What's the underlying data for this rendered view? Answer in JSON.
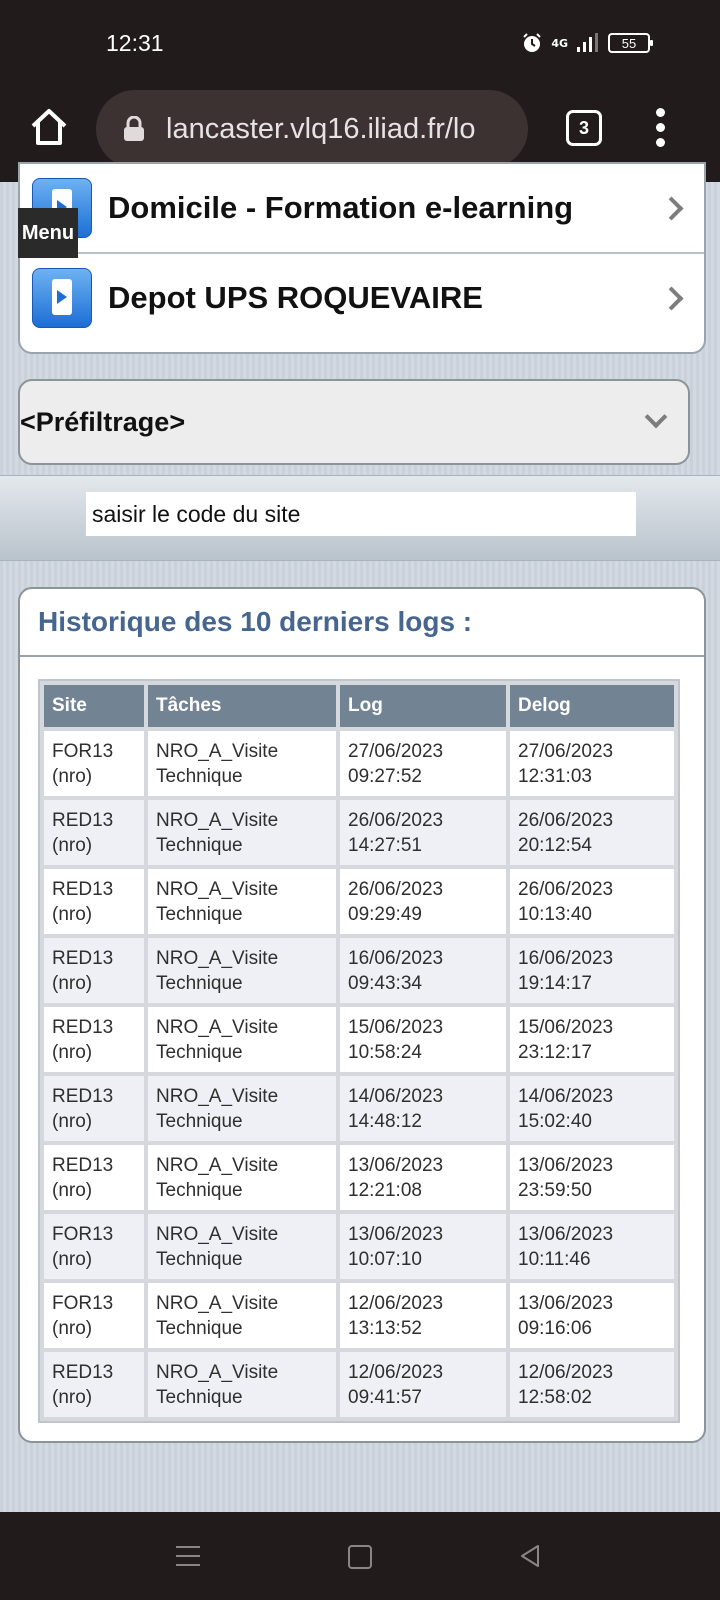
{
  "status_bar": {
    "time": "12:31",
    "network": "4G",
    "battery": "55"
  },
  "browser": {
    "url": "lancaster.vlq16.iliad.fr/lo",
    "tab_count": "3"
  },
  "menu_button_label": "Menu",
  "menu_items": [
    {
      "label": "Domicile - Formation e-learning",
      "icon": "phone-arrow-icon"
    },
    {
      "label": "Depot UPS ROQUEVAIRE",
      "icon": "phone-arrow-icon"
    }
  ],
  "prefilter": {
    "label": "<Préfiltrage>"
  },
  "site_search": {
    "placeholder": "saisir le code du site"
  },
  "history": {
    "title": "Historique des 10 derniers logs :",
    "columns": [
      "Site",
      "Tâches",
      "Log",
      "Delog"
    ],
    "rows": [
      {
        "site": "FOR13",
        "site_type": "(nro)",
        "task": "NRO_A_Visite",
        "task2": "Technique",
        "log_date": "27/06/2023",
        "log_time": "09:27:52",
        "delog_date": "27/06/2023",
        "delog_time": "12:31:03"
      },
      {
        "site": "RED13",
        "site_type": "(nro)",
        "task": "NRO_A_Visite",
        "task2": "Technique",
        "log_date": "26/06/2023",
        "log_time": "14:27:51",
        "delog_date": "26/06/2023",
        "delog_time": "20:12:54"
      },
      {
        "site": "RED13",
        "site_type": "(nro)",
        "task": "NRO_A_Visite",
        "task2": "Technique",
        "log_date": "26/06/2023",
        "log_time": "09:29:49",
        "delog_date": "26/06/2023",
        "delog_time": "10:13:40"
      },
      {
        "site": "RED13",
        "site_type": "(nro)",
        "task": "NRO_A_Visite",
        "task2": "Technique",
        "log_date": "16/06/2023",
        "log_time": "09:43:34",
        "delog_date": "16/06/2023",
        "delog_time": "19:14:17"
      },
      {
        "site": "RED13",
        "site_type": "(nro)",
        "task": "NRO_A_Visite",
        "task2": "Technique",
        "log_date": "15/06/2023",
        "log_time": "10:58:24",
        "delog_date": "15/06/2023",
        "delog_time": "23:12:17"
      },
      {
        "site": "RED13",
        "site_type": "(nro)",
        "task": "NRO_A_Visite",
        "task2": "Technique",
        "log_date": "14/06/2023",
        "log_time": "14:48:12",
        "delog_date": "14/06/2023",
        "delog_time": "15:02:40"
      },
      {
        "site": "RED13",
        "site_type": "(nro)",
        "task": "NRO_A_Visite",
        "task2": "Technique",
        "log_date": "13/06/2023",
        "log_time": "12:21:08",
        "delog_date": "13/06/2023",
        "delog_time": "23:59:50"
      },
      {
        "site": "FOR13",
        "site_type": "(nro)",
        "task": "NRO_A_Visite",
        "task2": "Technique",
        "log_date": "13/06/2023",
        "log_time": "10:07:10",
        "delog_date": "13/06/2023",
        "delog_time": "10:11:46"
      },
      {
        "site": "FOR13",
        "site_type": "(nro)",
        "task": "NRO_A_Visite",
        "task2": "Technique",
        "log_date": "12/06/2023",
        "log_time": "13:13:52",
        "delog_date": "13/06/2023",
        "delog_time": "09:16:06"
      },
      {
        "site": "RED13",
        "site_type": "(nro)",
        "task": "NRO_A_Visite",
        "task2": "Technique",
        "log_date": "12/06/2023",
        "log_time": "09:41:57",
        "delog_date": "12/06/2023",
        "delog_time": "12:58:02"
      }
    ]
  },
  "colors": {
    "browser_chrome": "#211b1b",
    "table_header": "#728394",
    "title_blue": "#46668f"
  }
}
